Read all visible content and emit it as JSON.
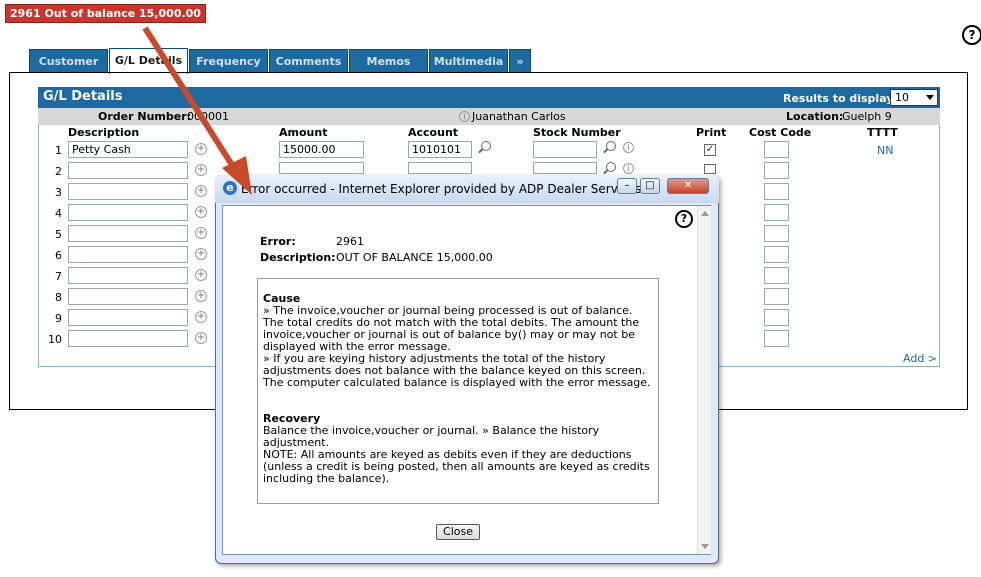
{
  "error_badge": "2961  Out of balance 15,000.00",
  "help_icon": "question-circle-icon",
  "tabs": [
    "Customer",
    "G/L Details",
    "Frequency",
    "Comments",
    "Memos",
    "Multimedia",
    "»"
  ],
  "gl": {
    "title": "G/L Details",
    "results_label": "Results to display:",
    "results_value": "10",
    "order_label": "Order Number:",
    "order_value": "000001",
    "customer_name": "Juanathan Carlos",
    "location_label": "Location:",
    "location_value": "Guelph 9",
    "columns": [
      "Description",
      "Amount",
      "Account",
      "Stock Number",
      "Print",
      "Cost Code",
      "TTTT"
    ],
    "rows": [
      {
        "num": "1",
        "description": "Petty Cash",
        "amount": "15000.00",
        "account": "1010101",
        "print": true,
        "tttt": "NN"
      },
      {
        "num": "2"
      },
      {
        "num": "3"
      },
      {
        "num": "4"
      },
      {
        "num": "5"
      },
      {
        "num": "6"
      },
      {
        "num": "7"
      },
      {
        "num": "8"
      },
      {
        "num": "9"
      },
      {
        "num": "10"
      }
    ],
    "add_link": "Add >"
  },
  "dialog": {
    "title": "Error occurred - Internet Explorer provided by ADP Dealer Services",
    "error_label": "Error:",
    "error_value": "2961",
    "desc_label": "Description:",
    "desc_value": "OUT OF BALANCE 15,000.00",
    "cause_title": "Cause",
    "cause_text": "» The invoice,voucher or journal being processed is out of balance. The total credits do not match with the total debits. The amount the invoice,voucher or journal is out of balance by() may or may not be displayed with the error message.\n» If you are keying history adjustments the total of the history adjustments does not balance with the balance keyed on this screen. The computer calculated balance is displayed with the error message.",
    "recovery_title": "Recovery",
    "recovery_text": "Balance the invoice,voucher or journal. » Balance the history adjustment.\nNOTE: All amounts are keyed as debits even if they are deductions (unless a credit is being posted, then all amounts are keyed as credits including the balance).",
    "close_label": "Close"
  },
  "colors": {
    "tab_blue": "#1c6aa0",
    "error_red": "#c8362d",
    "arrow": "#c94a2a"
  }
}
